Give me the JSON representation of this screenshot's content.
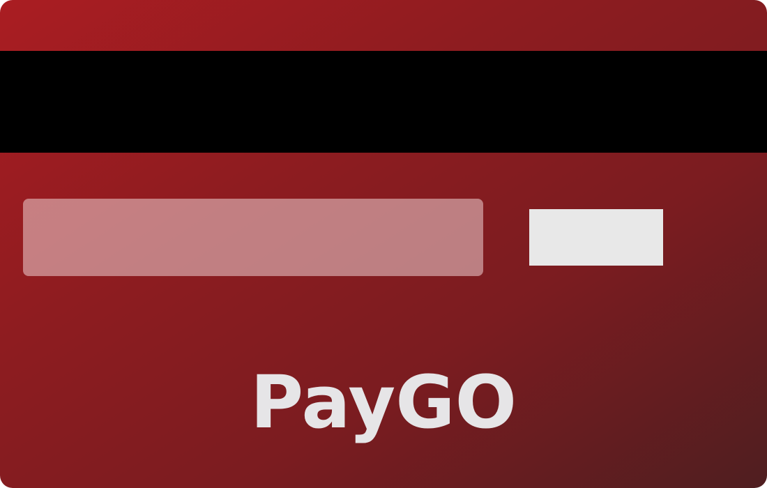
{
  "card": {
    "brand_name": "PayGO",
    "colors": {
      "gradient_start": "#aa1d22",
      "gradient_end": "#4f1e20",
      "magstripe": "#000000",
      "cvv_box": "#e8e8e8",
      "brand_text": "#e6e5e7"
    }
  }
}
